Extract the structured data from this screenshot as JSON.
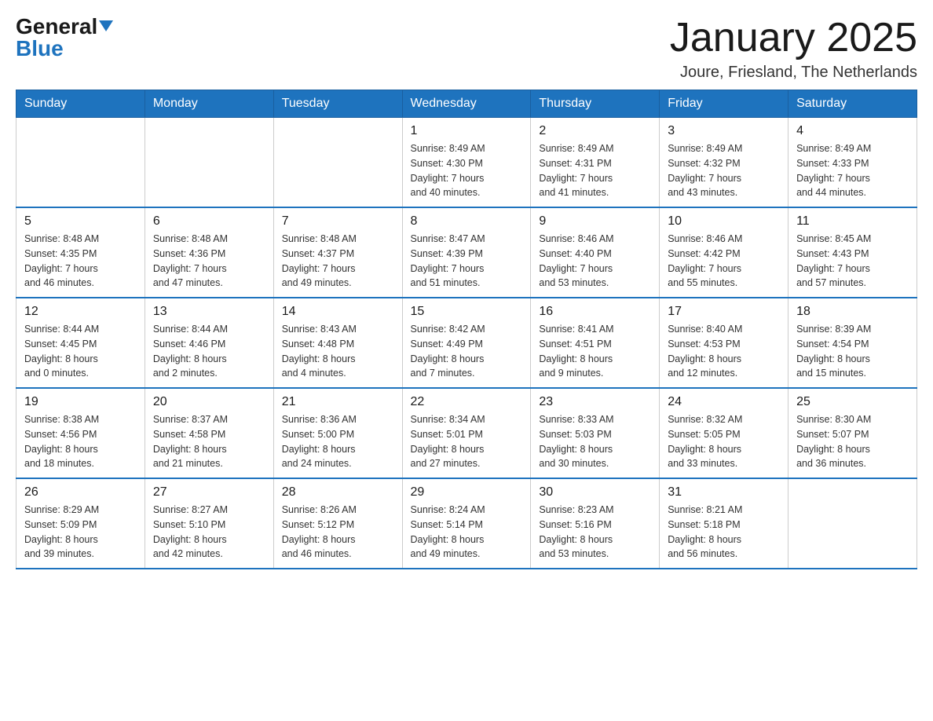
{
  "logo": {
    "general": "General",
    "blue": "Blue",
    "triangle": "▼"
  },
  "title": "January 2025",
  "subtitle": "Joure, Friesland, The Netherlands",
  "days_of_week": [
    "Sunday",
    "Monday",
    "Tuesday",
    "Wednesday",
    "Thursday",
    "Friday",
    "Saturday"
  ],
  "weeks": [
    [
      {
        "day": "",
        "info": ""
      },
      {
        "day": "",
        "info": ""
      },
      {
        "day": "",
        "info": ""
      },
      {
        "day": "1",
        "info": "Sunrise: 8:49 AM\nSunset: 4:30 PM\nDaylight: 7 hours\nand 40 minutes."
      },
      {
        "day": "2",
        "info": "Sunrise: 8:49 AM\nSunset: 4:31 PM\nDaylight: 7 hours\nand 41 minutes."
      },
      {
        "day": "3",
        "info": "Sunrise: 8:49 AM\nSunset: 4:32 PM\nDaylight: 7 hours\nand 43 minutes."
      },
      {
        "day": "4",
        "info": "Sunrise: 8:49 AM\nSunset: 4:33 PM\nDaylight: 7 hours\nand 44 minutes."
      }
    ],
    [
      {
        "day": "5",
        "info": "Sunrise: 8:48 AM\nSunset: 4:35 PM\nDaylight: 7 hours\nand 46 minutes."
      },
      {
        "day": "6",
        "info": "Sunrise: 8:48 AM\nSunset: 4:36 PM\nDaylight: 7 hours\nand 47 minutes."
      },
      {
        "day": "7",
        "info": "Sunrise: 8:48 AM\nSunset: 4:37 PM\nDaylight: 7 hours\nand 49 minutes."
      },
      {
        "day": "8",
        "info": "Sunrise: 8:47 AM\nSunset: 4:39 PM\nDaylight: 7 hours\nand 51 minutes."
      },
      {
        "day": "9",
        "info": "Sunrise: 8:46 AM\nSunset: 4:40 PM\nDaylight: 7 hours\nand 53 minutes."
      },
      {
        "day": "10",
        "info": "Sunrise: 8:46 AM\nSunset: 4:42 PM\nDaylight: 7 hours\nand 55 minutes."
      },
      {
        "day": "11",
        "info": "Sunrise: 8:45 AM\nSunset: 4:43 PM\nDaylight: 7 hours\nand 57 minutes."
      }
    ],
    [
      {
        "day": "12",
        "info": "Sunrise: 8:44 AM\nSunset: 4:45 PM\nDaylight: 8 hours\nand 0 minutes."
      },
      {
        "day": "13",
        "info": "Sunrise: 8:44 AM\nSunset: 4:46 PM\nDaylight: 8 hours\nand 2 minutes."
      },
      {
        "day": "14",
        "info": "Sunrise: 8:43 AM\nSunset: 4:48 PM\nDaylight: 8 hours\nand 4 minutes."
      },
      {
        "day": "15",
        "info": "Sunrise: 8:42 AM\nSunset: 4:49 PM\nDaylight: 8 hours\nand 7 minutes."
      },
      {
        "day": "16",
        "info": "Sunrise: 8:41 AM\nSunset: 4:51 PM\nDaylight: 8 hours\nand 9 minutes."
      },
      {
        "day": "17",
        "info": "Sunrise: 8:40 AM\nSunset: 4:53 PM\nDaylight: 8 hours\nand 12 minutes."
      },
      {
        "day": "18",
        "info": "Sunrise: 8:39 AM\nSunset: 4:54 PM\nDaylight: 8 hours\nand 15 minutes."
      }
    ],
    [
      {
        "day": "19",
        "info": "Sunrise: 8:38 AM\nSunset: 4:56 PM\nDaylight: 8 hours\nand 18 minutes."
      },
      {
        "day": "20",
        "info": "Sunrise: 8:37 AM\nSunset: 4:58 PM\nDaylight: 8 hours\nand 21 minutes."
      },
      {
        "day": "21",
        "info": "Sunrise: 8:36 AM\nSunset: 5:00 PM\nDaylight: 8 hours\nand 24 minutes."
      },
      {
        "day": "22",
        "info": "Sunrise: 8:34 AM\nSunset: 5:01 PM\nDaylight: 8 hours\nand 27 minutes."
      },
      {
        "day": "23",
        "info": "Sunrise: 8:33 AM\nSunset: 5:03 PM\nDaylight: 8 hours\nand 30 minutes."
      },
      {
        "day": "24",
        "info": "Sunrise: 8:32 AM\nSunset: 5:05 PM\nDaylight: 8 hours\nand 33 minutes."
      },
      {
        "day": "25",
        "info": "Sunrise: 8:30 AM\nSunset: 5:07 PM\nDaylight: 8 hours\nand 36 minutes."
      }
    ],
    [
      {
        "day": "26",
        "info": "Sunrise: 8:29 AM\nSunset: 5:09 PM\nDaylight: 8 hours\nand 39 minutes."
      },
      {
        "day": "27",
        "info": "Sunrise: 8:27 AM\nSunset: 5:10 PM\nDaylight: 8 hours\nand 42 minutes."
      },
      {
        "day": "28",
        "info": "Sunrise: 8:26 AM\nSunset: 5:12 PM\nDaylight: 8 hours\nand 46 minutes."
      },
      {
        "day": "29",
        "info": "Sunrise: 8:24 AM\nSunset: 5:14 PM\nDaylight: 8 hours\nand 49 minutes."
      },
      {
        "day": "30",
        "info": "Sunrise: 8:23 AM\nSunset: 5:16 PM\nDaylight: 8 hours\nand 53 minutes."
      },
      {
        "day": "31",
        "info": "Sunrise: 8:21 AM\nSunset: 5:18 PM\nDaylight: 8 hours\nand 56 minutes."
      },
      {
        "day": "",
        "info": ""
      }
    ]
  ]
}
